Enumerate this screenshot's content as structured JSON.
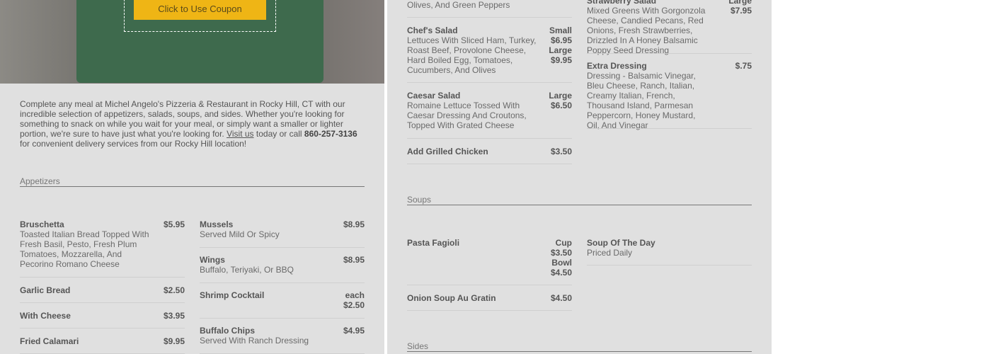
{
  "coupon": {
    "button_label": "Click to Use Coupon"
  },
  "intro": {
    "text_before": "Complete any meal at Michel Angelo's Pizzeria & Restaurant in Rocky Hill, CT with our incredible selection of appetizers, salads, soups, and sides. Whether you're looking for something to snack on while you wait for your meal, or simply want a smaller or lighter portion, we're sure to have just what you're looking for. ",
    "link_label": "Visit us",
    "text_middle": " today or call ",
    "phone": "860-257-3136",
    "text_after": " for convenient delivery services from our Rocky Hill location!"
  },
  "appetizers": {
    "title": "Appetizers",
    "items": [
      {
        "name": "Bruschetta",
        "price": "$5.95",
        "desc": "Toasted Italian Bread Topped With Fresh Basil, Pesto, Fresh Plum Tomatoes, Mozzarella, And Pecorino Romano Cheese"
      },
      {
        "name": "Garlic Bread",
        "price": "$2.50",
        "desc": ""
      },
      {
        "name": "With Cheese",
        "price": "$3.95",
        "desc": ""
      },
      {
        "name": "Fried Calamari",
        "price": "$9.95",
        "desc": ""
      },
      {
        "name": "Mussels",
        "price": "$8.95",
        "desc": "Served Mild Or Spicy"
      },
      {
        "name": "Wings",
        "price": "$8.95",
        "desc": "Buffalo, Teriyaki, Or BBQ"
      },
      {
        "name": "Shrimp Cocktail",
        "price_line1": "each",
        "price_line2": "$2.50",
        "desc": ""
      },
      {
        "name": "Buffalo Chips",
        "price": "$4.95",
        "desc": "Served With Ranch Dressing"
      }
    ]
  },
  "salads": {
    "top_fragment": "Olives, And Green Peppers",
    "items": [
      {
        "name": "Chef's Salad",
        "price_lines": [
          "Small",
          "$6.95",
          "Large",
          "$9.95"
        ],
        "desc": "Lettuces With Sliced Ham, Turkey, Roast Beef, Provolone Cheese, Hard Boiled Egg, Tomatoes, Cucumbers, And Olives"
      },
      {
        "name": "Caesar Salad",
        "price_lines": [
          "Large",
          "$6.50"
        ],
        "desc": "Romaine Lettuce Tossed With Caesar Dressing And Croutons, Topped With Grated Cheese"
      },
      {
        "name": "Add Grilled Chicken",
        "price": "$3.50",
        "desc": ""
      },
      {
        "name": "Strawberry Salad",
        "price_lines": [
          "Large",
          "$7.95"
        ],
        "desc": "Mixed Greens With Gorgonzola Cheese, Candied Pecans, Red Onions, Fresh Strawberries, Drizzled In A Honey Balsamic Poppy Seed Dressing"
      },
      {
        "name": "Extra Dressing",
        "price": "$.75",
        "desc": "Dressing - Balsamic Vinegar, Bleu Cheese, Ranch, Italian, Creamy Italian, French, Thousand Island, Parmesan Peppercorn, Honey Mustard, Oil, And Vinegar"
      }
    ]
  },
  "soups": {
    "title": "Soups",
    "items": [
      {
        "name": "Pasta Fagioli",
        "price_lines": [
          "Cup",
          "$3.50",
          "Bowl",
          "$4.50"
        ],
        "desc": ""
      },
      {
        "name": "Onion Soup Au Gratin",
        "price": "$4.50",
        "desc": ""
      },
      {
        "name": "Soup Of The Day",
        "price": "",
        "desc": "Priced Daily"
      }
    ]
  },
  "sides": {
    "title": "Sides"
  }
}
